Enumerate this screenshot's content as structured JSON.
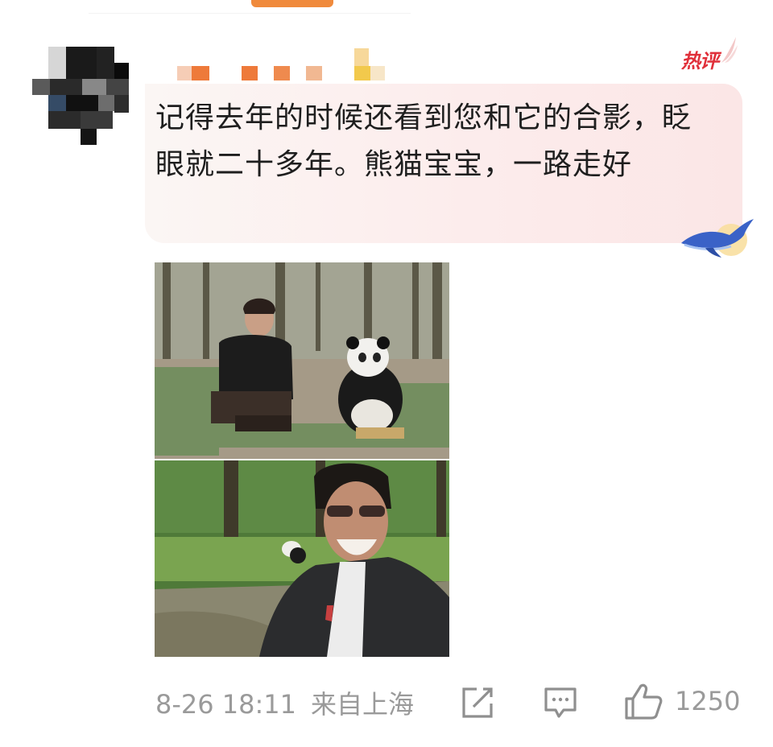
{
  "comment": {
    "badge": "热评",
    "text": "记得去年的时候还看到您和它的合影，眨眼就二十多年。熊猫宝宝，一路走好",
    "photos": [
      "photo-man-with-panda-bamboo",
      "photo-selfie-panda-background"
    ],
    "meta": {
      "time": "8-26 18:11",
      "source": "来自上海"
    },
    "actions": {
      "share_icon": "share-icon",
      "reply_icon": "comment-icon",
      "like_icon": "thumbs-up-icon",
      "like_count": "1250"
    }
  },
  "colors": {
    "accent_orange": "#f08a3c",
    "hot_red": "#e0303a",
    "meta_gray": "#9a9a9a",
    "bubble_pink": "#fcecec"
  }
}
